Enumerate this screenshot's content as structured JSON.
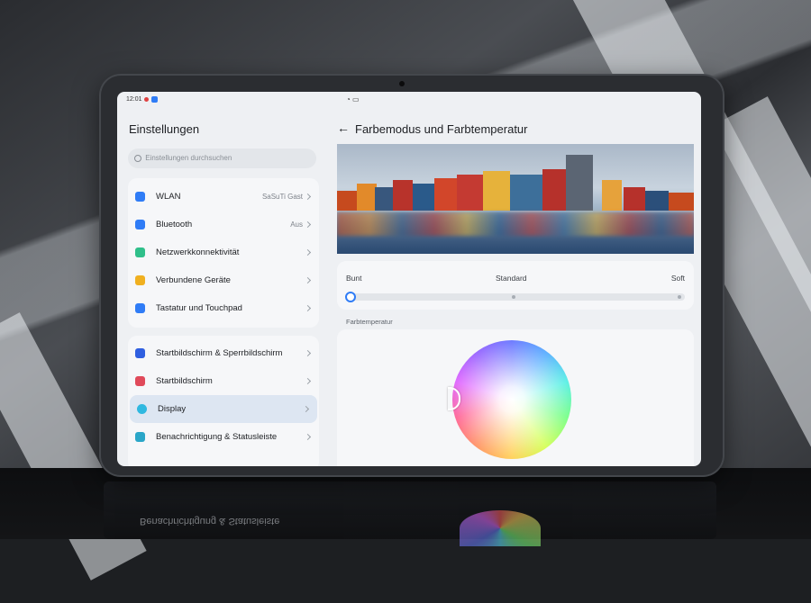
{
  "status_bar": {
    "time": "12:01"
  },
  "settings": {
    "title": "Einstellungen",
    "search_placeholder": "Einstellungen durchsuchen",
    "group1": [
      {
        "label": "WLAN",
        "value": "SaSuTi Gast",
        "icon": "wifi-icon",
        "color": "#2f7cf6"
      },
      {
        "label": "Bluetooth",
        "value": "Aus",
        "icon": "bluetooth-icon",
        "color": "#2f7cf6"
      },
      {
        "label": "Netzwerkkonnektivität",
        "value": "",
        "icon": "network-icon",
        "color": "#2fbf8a"
      },
      {
        "label": "Verbundene Geräte",
        "value": "",
        "icon": "devices-icon",
        "color": "#f0b020"
      },
      {
        "label": "Tastatur und Touchpad",
        "value": "",
        "icon": "keyboard-icon",
        "color": "#2f7cf6"
      }
    ],
    "group2": [
      {
        "label": "Startbildschirm & Sperrbildschirm",
        "icon": "shirt-icon",
        "color": "#2f5fe0"
      },
      {
        "label": "Startbildschirm",
        "icon": "home-icon",
        "color": "#e04a5a"
      },
      {
        "label": "Display",
        "icon": "brightness-icon",
        "color": "#2fb8e0",
        "active": true
      },
      {
        "label": "Benachrichtigung & Statusleiste",
        "icon": "notification-icon",
        "color": "#2aa6c8"
      }
    ]
  },
  "detail": {
    "title": "Farbemodus und Farbtemperatur",
    "modes": {
      "left": "Bunt",
      "middle": "Standard",
      "right": "Soft",
      "selected_index": 0
    },
    "temperature_label": "Farbtemperatur"
  },
  "reflection_text": "Benachrichtigung & Statusleiste"
}
